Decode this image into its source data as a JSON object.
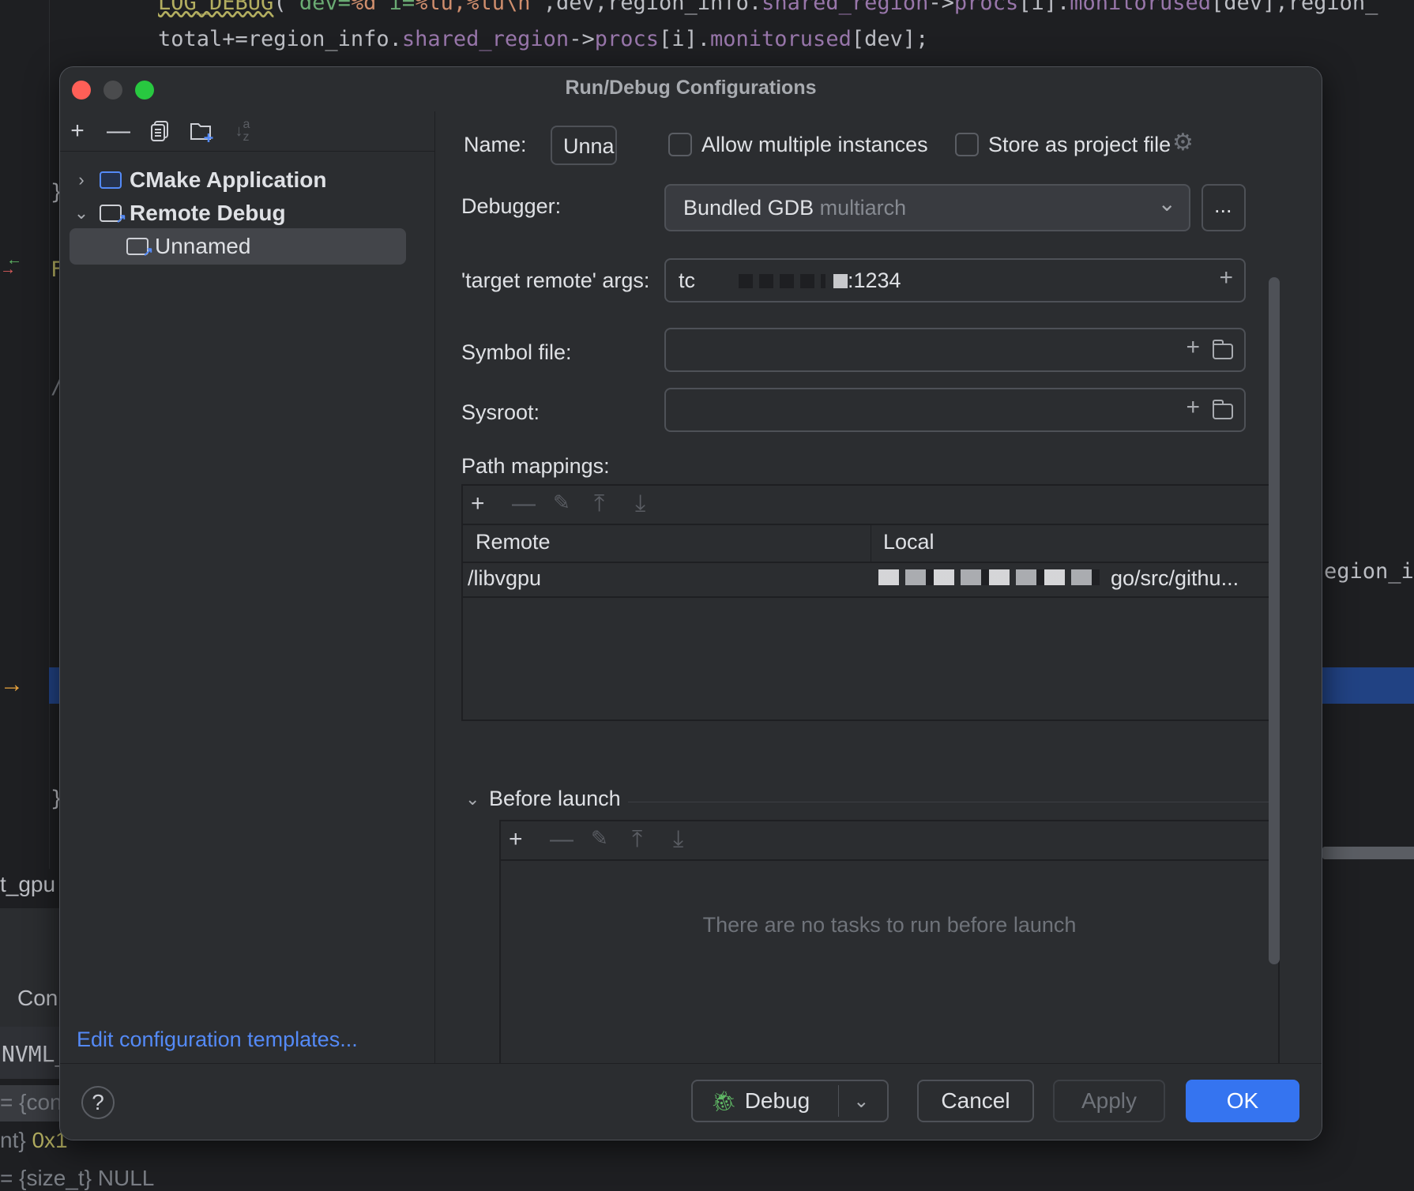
{
  "editor": {
    "line1_fn": "LOG_DEBUG",
    "line1_rest_a": "(",
    "line1_str": "\"dev=",
    "line1_esc1": "%d",
    "line1_str2": " i=",
    "line1_esc2": "%lu,%lu\\n",
    "line1_strend": "\"",
    "line1_rest_b": ",dev,region_info.",
    "line1_fld1": "shared_region",
    "line1_rest_c": "->",
    "line1_fld2": "procs",
    "line1_rest_d": "[i].",
    "line1_fld3": "monitorused",
    "line1_rest_e": "[dev],region_",
    "line2_a": "total+=region_info.",
    "line2_fld1": "shared_region",
    "line2_b": "->",
    "line2_fld2": "procs",
    "line2_c": "[i].",
    "line2_fld3": "monitorused",
    "line2_d": "[dev];",
    "right_fragment": "egion_i",
    "left_fragments": [
      "}",
      "F",
      "/",
      "}"
    ],
    "bottom_left": {
      "tab": "t_gpu",
      "con": "Con",
      "nvml": "NVML_",
      "var1": "= {con",
      "var2_type": "nt}",
      "var2_val": "0x1",
      "var3": "= {size_t} NULL"
    }
  },
  "dialog": {
    "title": "Run/Debug Configurations",
    "sidebar": {
      "toolbar": [
        "add-icon",
        "remove-icon",
        "copy-icon",
        "new-folder-icon",
        "sort-icon"
      ],
      "tree": [
        {
          "label": "CMake Application",
          "expanded": false,
          "level": 0
        },
        {
          "label": "Remote Debug",
          "expanded": true,
          "level": 0
        },
        {
          "label": "Unnamed",
          "level": 1,
          "selected": true
        }
      ],
      "edit_templates_link": "Edit configuration templates..."
    },
    "form": {
      "name_label": "Name:",
      "name_value": "Unna",
      "allow_multiple_label": "Allow multiple instances",
      "allow_multiple_checked": false,
      "store_project_label": "Store as project file",
      "store_project_checked": false,
      "debugger_label": "Debugger:",
      "debugger_value": "Bundled GDB",
      "debugger_hint": "multiarch",
      "more_button": "...",
      "target_label": "'target remote' args:",
      "target_prefix": "tc",
      "target_suffix": ":1234",
      "symbol_label": "Symbol file:",
      "symbol_value": "",
      "sysroot_label": "Sysroot:",
      "sysroot_value": "",
      "path_mappings_label": "Path mappings:",
      "path_mappings": {
        "columns": [
          "Remote",
          "Local"
        ],
        "rows": [
          {
            "remote": "/libvgpu",
            "local": "go/src/githu..."
          }
        ]
      },
      "before_launch_label": "Before launch",
      "before_launch_empty": "There are no tasks to run before launch"
    },
    "footer": {
      "help": "?",
      "debug_button": "Debug",
      "cancel_button": "Cancel",
      "apply_button": "Apply",
      "ok_button": "OK"
    },
    "colors": {
      "accent": "#3574f0",
      "link": "#548af7"
    }
  }
}
